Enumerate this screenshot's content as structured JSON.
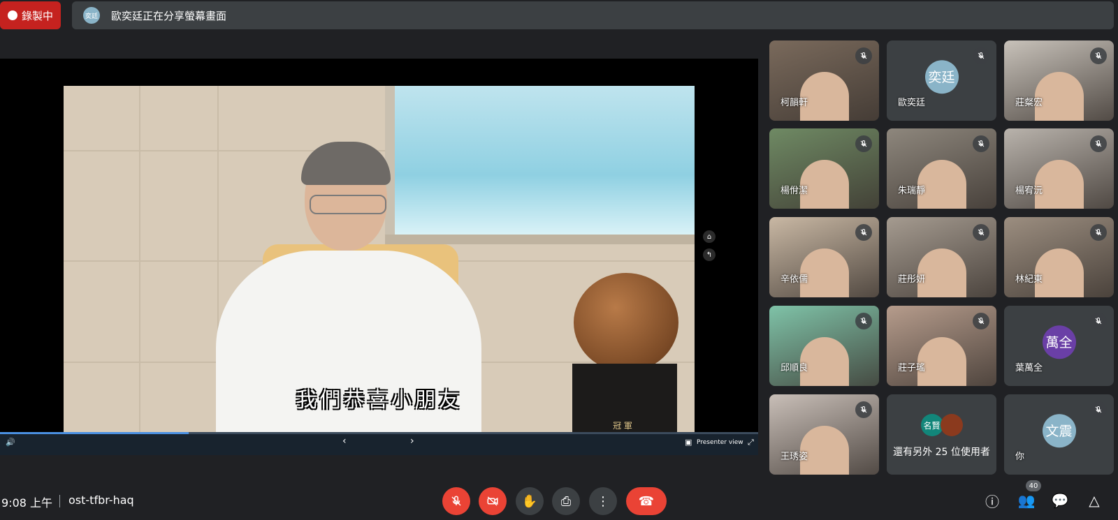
{
  "top": {
    "recording_label": "錄製中",
    "share_avatar": "奕廷",
    "share_text": "歐奕廷正在分享螢幕畫面"
  },
  "presentation": {
    "caption": "我們恭喜小朋友",
    "trophy_text": "冠 軍",
    "window_text": "",
    "presenter_view": "Presenter view"
  },
  "participants": [
    {
      "name": "柯韻軒",
      "type": "video",
      "color": "#7a6a5c"
    },
    {
      "name": "歐奕廷",
      "type": "avatar",
      "initials": "奕廷",
      "color": "#8ab4c8"
    },
    {
      "name": "莊粲宏",
      "type": "video",
      "color": "#c8c2ba"
    },
    {
      "name": "楊佾潔",
      "type": "video",
      "color": "#6f8a64"
    },
    {
      "name": "朱瑞靜",
      "type": "video",
      "color": "#8e877d"
    },
    {
      "name": "楊宥沅",
      "type": "video",
      "color": "#b9b3ac"
    },
    {
      "name": "辛依儒",
      "type": "video",
      "color": "#c9b8a4"
    },
    {
      "name": "莊彤妍",
      "type": "video",
      "color": "#a59b90"
    },
    {
      "name": "林紀東",
      "type": "video",
      "color": "#9c8e80"
    },
    {
      "name": "邱順良",
      "type": "video",
      "color": "#7fc3a8"
    },
    {
      "name": "莊子瑤",
      "type": "video",
      "color": "#b69c8c"
    },
    {
      "name": "葉萬全",
      "type": "avatar",
      "initials": "萬全",
      "color": "#6a3fa6"
    },
    {
      "name": "王琇姿",
      "type": "video",
      "color": "#c9bfb8"
    },
    {
      "name": "還有另外 25 位使用者",
      "type": "more",
      "avatars": [
        "名賢",
        ""
      ]
    },
    {
      "name": "你",
      "type": "avatar",
      "initials": "文震",
      "color": "#8ab4c8"
    }
  ],
  "bottom": {
    "time": "9:08 上午",
    "meeting_code": "ost-tfbr-haq",
    "people_count": "40"
  },
  "colors": {
    "background": "#202124",
    "danger": "#ea4335",
    "control": "#3c4043"
  }
}
